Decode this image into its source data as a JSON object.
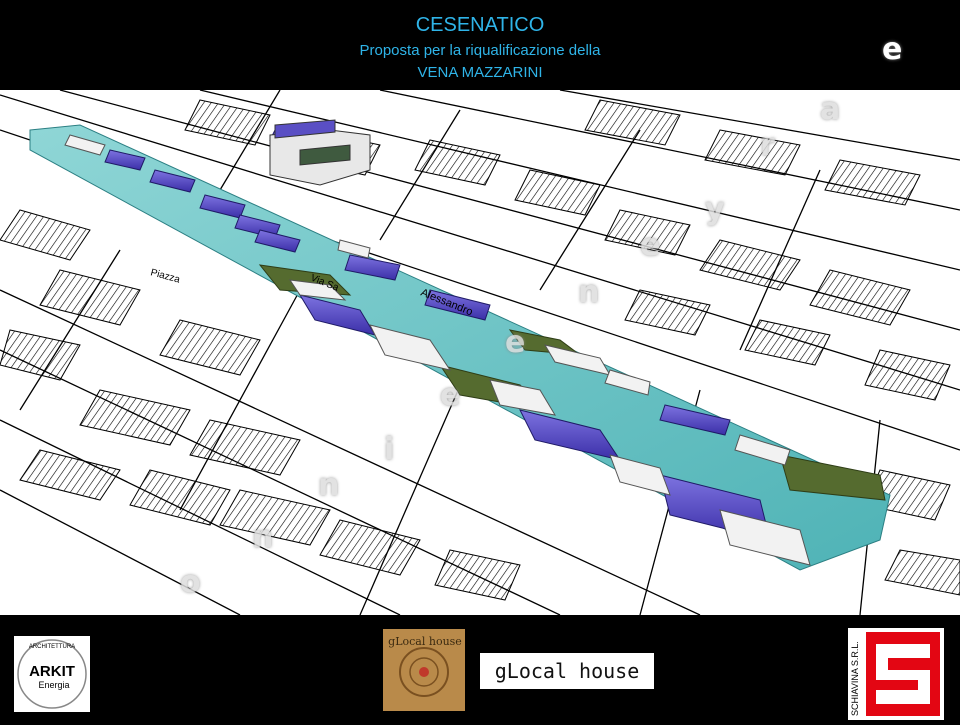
{
  "header": {
    "title": "CESENATICO",
    "subtitle_1": "Proposta per la riqualificazione della",
    "subtitle_2": "VENA MAZZARINI"
  },
  "render": {
    "street_label_1": "Via Sa",
    "street_label_2": "Alessandro",
    "street_label_3": "Piazza"
  },
  "watermark": {
    "letters": [
      "c",
      "o",
      "n",
      "n",
      "i",
      "e",
      "e",
      "n",
      "e",
      "y",
      "r",
      "a",
      "l",
      "e"
    ]
  },
  "footer": {
    "arkit_name": "ARKIT",
    "arkit_sub": "Energia",
    "arkit_ring_top": "ARCHITETTURA",
    "arkit_ring_left": "AMBIENTE",
    "arkit_ring_right": "TECNOLOGIA",
    "glocal_image_text": "gLocal house",
    "glocal_logo_text": "gLocal house",
    "schiavina_text": "SCHIAVINA S.R.L."
  },
  "colors": {
    "title": "#2fb4e8",
    "canal": "#6cc7c9",
    "roof_blue": "#5a4fc4",
    "green_roof": "#556b2f"
  }
}
